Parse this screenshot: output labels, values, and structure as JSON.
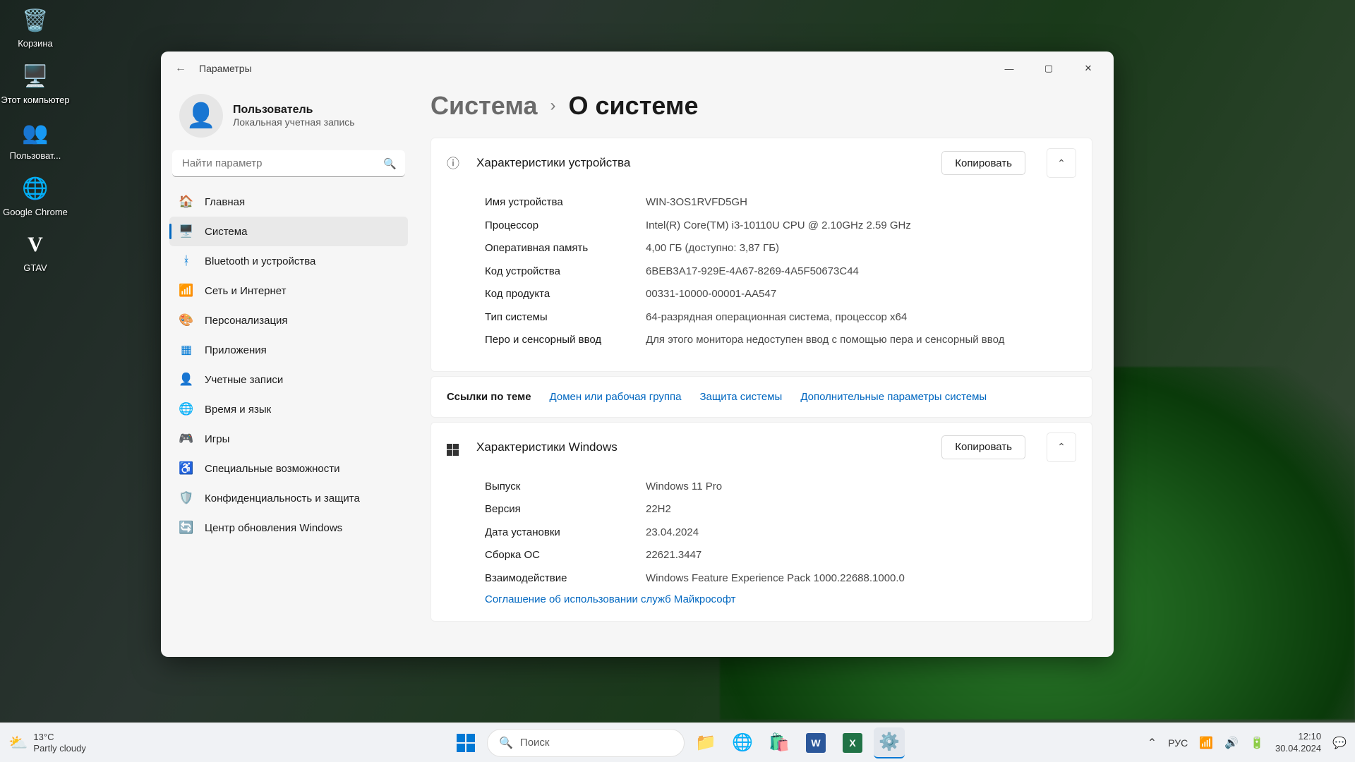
{
  "desktop": {
    "items": [
      {
        "label": "Корзина",
        "icon": "🗑️"
      },
      {
        "label": "Этот компьютер",
        "icon": "🖥️"
      },
      {
        "label": "Пользоват...",
        "icon": "👥"
      },
      {
        "label": "Google Chrome",
        "icon": "🌐"
      },
      {
        "label": "GTAV",
        "icon": "V"
      }
    ]
  },
  "window": {
    "title": "Параметры",
    "user": {
      "name": "Пользователь",
      "type": "Локальная учетная запись"
    },
    "search_placeholder": "Найти параметр",
    "nav": [
      {
        "label": "Главная",
        "icon": "🏠"
      },
      {
        "label": "Система",
        "icon": "🖥️",
        "active": true
      },
      {
        "label": "Bluetooth и устройства",
        "icon": "ᚼ"
      },
      {
        "label": "Сеть и Интернет",
        "icon": "📶"
      },
      {
        "label": "Персонализация",
        "icon": "🎨"
      },
      {
        "label": "Приложения",
        "icon": "▦"
      },
      {
        "label": "Учетные записи",
        "icon": "👤"
      },
      {
        "label": "Время и язык",
        "icon": "🌐"
      },
      {
        "label": "Игры",
        "icon": "🎮"
      },
      {
        "label": "Специальные возможности",
        "icon": "♿"
      },
      {
        "label": "Конфиденциальность и защита",
        "icon": "🛡️"
      },
      {
        "label": "Центр обновления Windows",
        "icon": "🔄"
      }
    ],
    "crumb": {
      "parent": "Система",
      "current": "О системе"
    },
    "device_card": {
      "title": "Характеристики устройства",
      "copy": "Копировать",
      "props": [
        {
          "k": "Имя устройства",
          "v": "WIN-3OS1RVFD5GH"
        },
        {
          "k": "Процессор",
          "v": "Intel(R) Core(TM) i3-10110U CPU @ 2.10GHz   2.59 GHz"
        },
        {
          "k": "Оперативная память",
          "v": "4,00 ГБ (доступно: 3,87 ГБ)"
        },
        {
          "k": "Код устройства",
          "v": "6BEB3A17-929E-4A67-8269-4A5F50673C44"
        },
        {
          "k": "Код продукта",
          "v": "00331-10000-00001-AA547"
        },
        {
          "k": "Тип системы",
          "v": "64-разрядная операционная система, процессор x64"
        },
        {
          "k": "Перо и сенсорный ввод",
          "v": "Для этого монитора недоступен ввод с помощью пера и сенсорный ввод"
        }
      ]
    },
    "links": {
      "label": "Ссылки по теме",
      "items": [
        "Домен или рабочая группа",
        "Защита системы",
        "Дополнительные параметры системы"
      ]
    },
    "windows_card": {
      "title": "Характеристики Windows",
      "copy": "Копировать",
      "props": [
        {
          "k": "Выпуск",
          "v": "Windows 11 Pro"
        },
        {
          "k": "Версия",
          "v": "22H2"
        },
        {
          "k": "Дата установки",
          "v": "23.04.2024"
        },
        {
          "k": "Сборка ОС",
          "v": "22621.3447"
        },
        {
          "k": "Взаимодействие",
          "v": "Windows Feature Experience Pack 1000.22688.1000.0"
        }
      ],
      "agreement": "Соглашение об использовании служб Майкрософт"
    }
  },
  "taskbar": {
    "weather": {
      "temp": "13°C",
      "desc": "Partly cloudy"
    },
    "search": "Поиск",
    "tray": {
      "lang": "РУС",
      "time": "12:10",
      "date": "30.04.2024"
    }
  }
}
